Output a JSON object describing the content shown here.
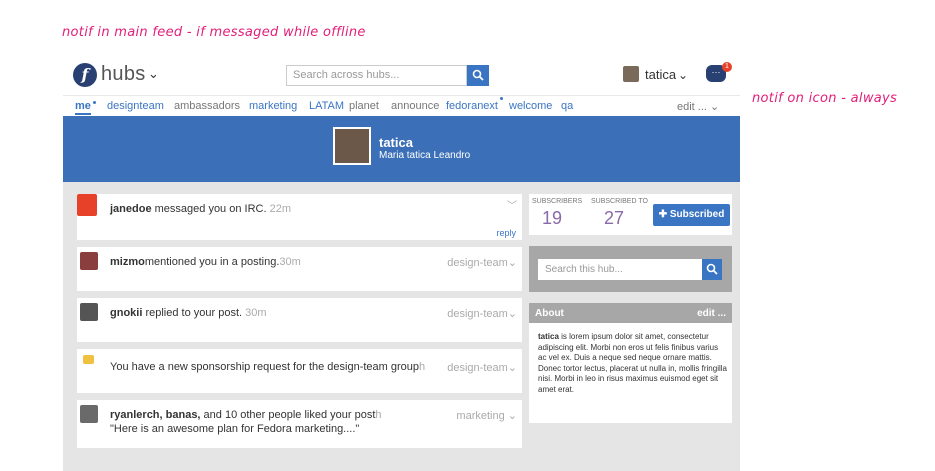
{
  "annotations": {
    "feed_note": "notif in main feed - if messaged while offline",
    "icon_note": "notif on icon - always"
  },
  "header": {
    "brand": "hubs",
    "brand_caret": "⌄",
    "search_placeholder": "Search across hubs...",
    "username": "tatica",
    "user_caret": "⌄",
    "chat_glyph": "···",
    "chat_badge": "1"
  },
  "tabs": {
    "items": [
      "me",
      "designteam",
      "ambassadors",
      "marketing",
      "LATAM",
      "planet",
      "announce",
      "fedoranext",
      "welcome",
      "qa"
    ],
    "edit": "edit ... ⌄"
  },
  "profile": {
    "name": "tatica",
    "fullname": "Maria tatica Leandro"
  },
  "feed": [
    {
      "user": "janedoe",
      "text": " messaged you on IRC.",
      "time": " 22m",
      "group": "",
      "action": "reply"
    },
    {
      "user": "mizmo",
      "text": "mentioned you in a posting.",
      "time": "30m",
      "group": "design-team⌄"
    },
    {
      "user": "gnokii",
      "text": " replied to your post.",
      "time": " 30m",
      "group": "design-team⌄"
    },
    {
      "user": "",
      "text": "You have a new sponsorship request for the design-team group",
      "time": "h",
      "group": "design-team⌄"
    },
    {
      "user": "ryanlerch, banas,",
      "text": " and 10 other people liked your post",
      "time": "h",
      "group": "marketing ⌄",
      "quote": "\"Here is an awesome plan for Fedora marketing....\""
    }
  ],
  "stats": {
    "subscribers_label": "SUBSCRIBERS",
    "subscribers": "19",
    "subscribed_to_label": "SUBSCRIBED TO",
    "subscribed_to": "27",
    "subscribe_button": "✚ Subscribed"
  },
  "sidebar": {
    "search_placeholder": "Search this hub...",
    "about_title": "About",
    "about_edit": "edit ...",
    "about_name": "tatica",
    "about_text": " is lorem ipsum dolor sit amet, consectetur adipiscing elit. Morbi non eros ut felis finibus varius ac vel ex. Duis a neque sed neque ornare mattis. Donec tortor lectus, placerat ut nulla in, mollis fringilla nisi. Morbi in leo in risus maximus euismod eget sit amet erat."
  },
  "colors": {
    "accent": "#3a75c4",
    "banner": "#3b6fb8",
    "annotation": "#e0207a"
  }
}
